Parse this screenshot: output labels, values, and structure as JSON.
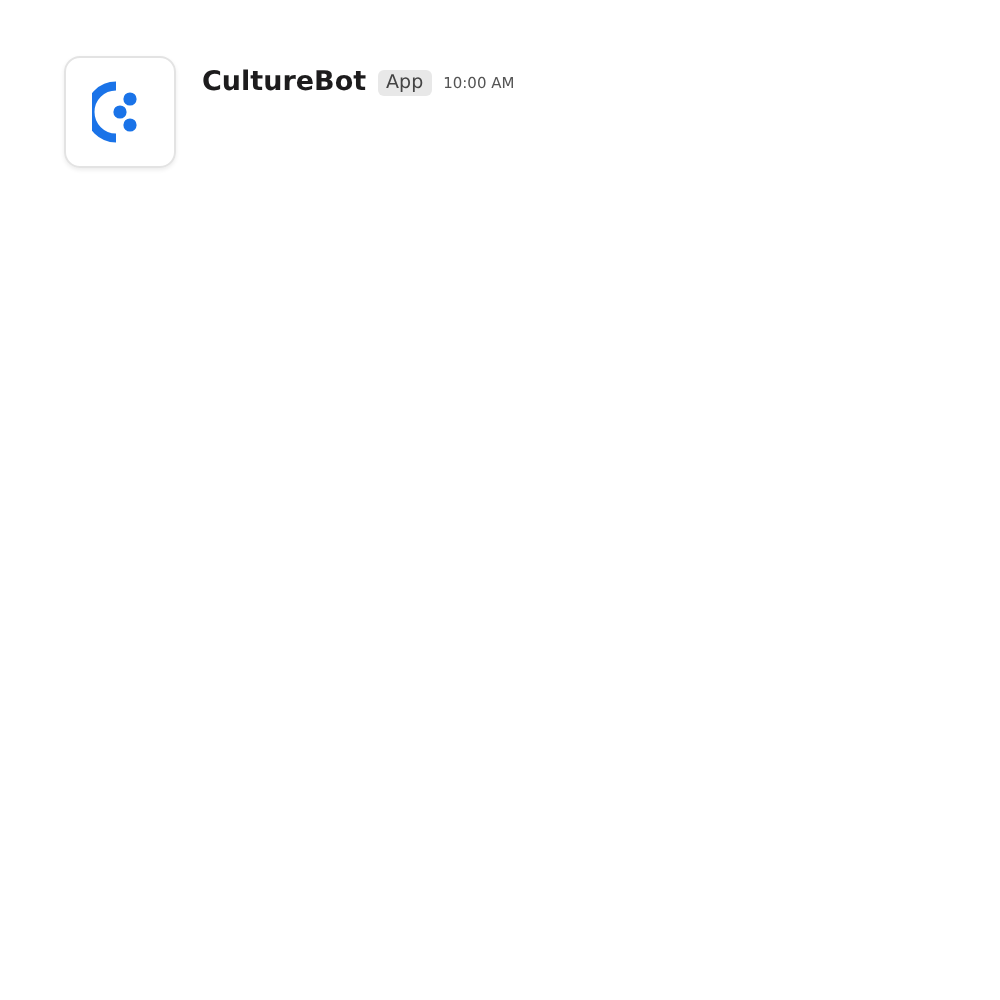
{
  "message": {
    "sender": "CultureBot",
    "badge": "App",
    "time": "10:00 AM"
  }
}
